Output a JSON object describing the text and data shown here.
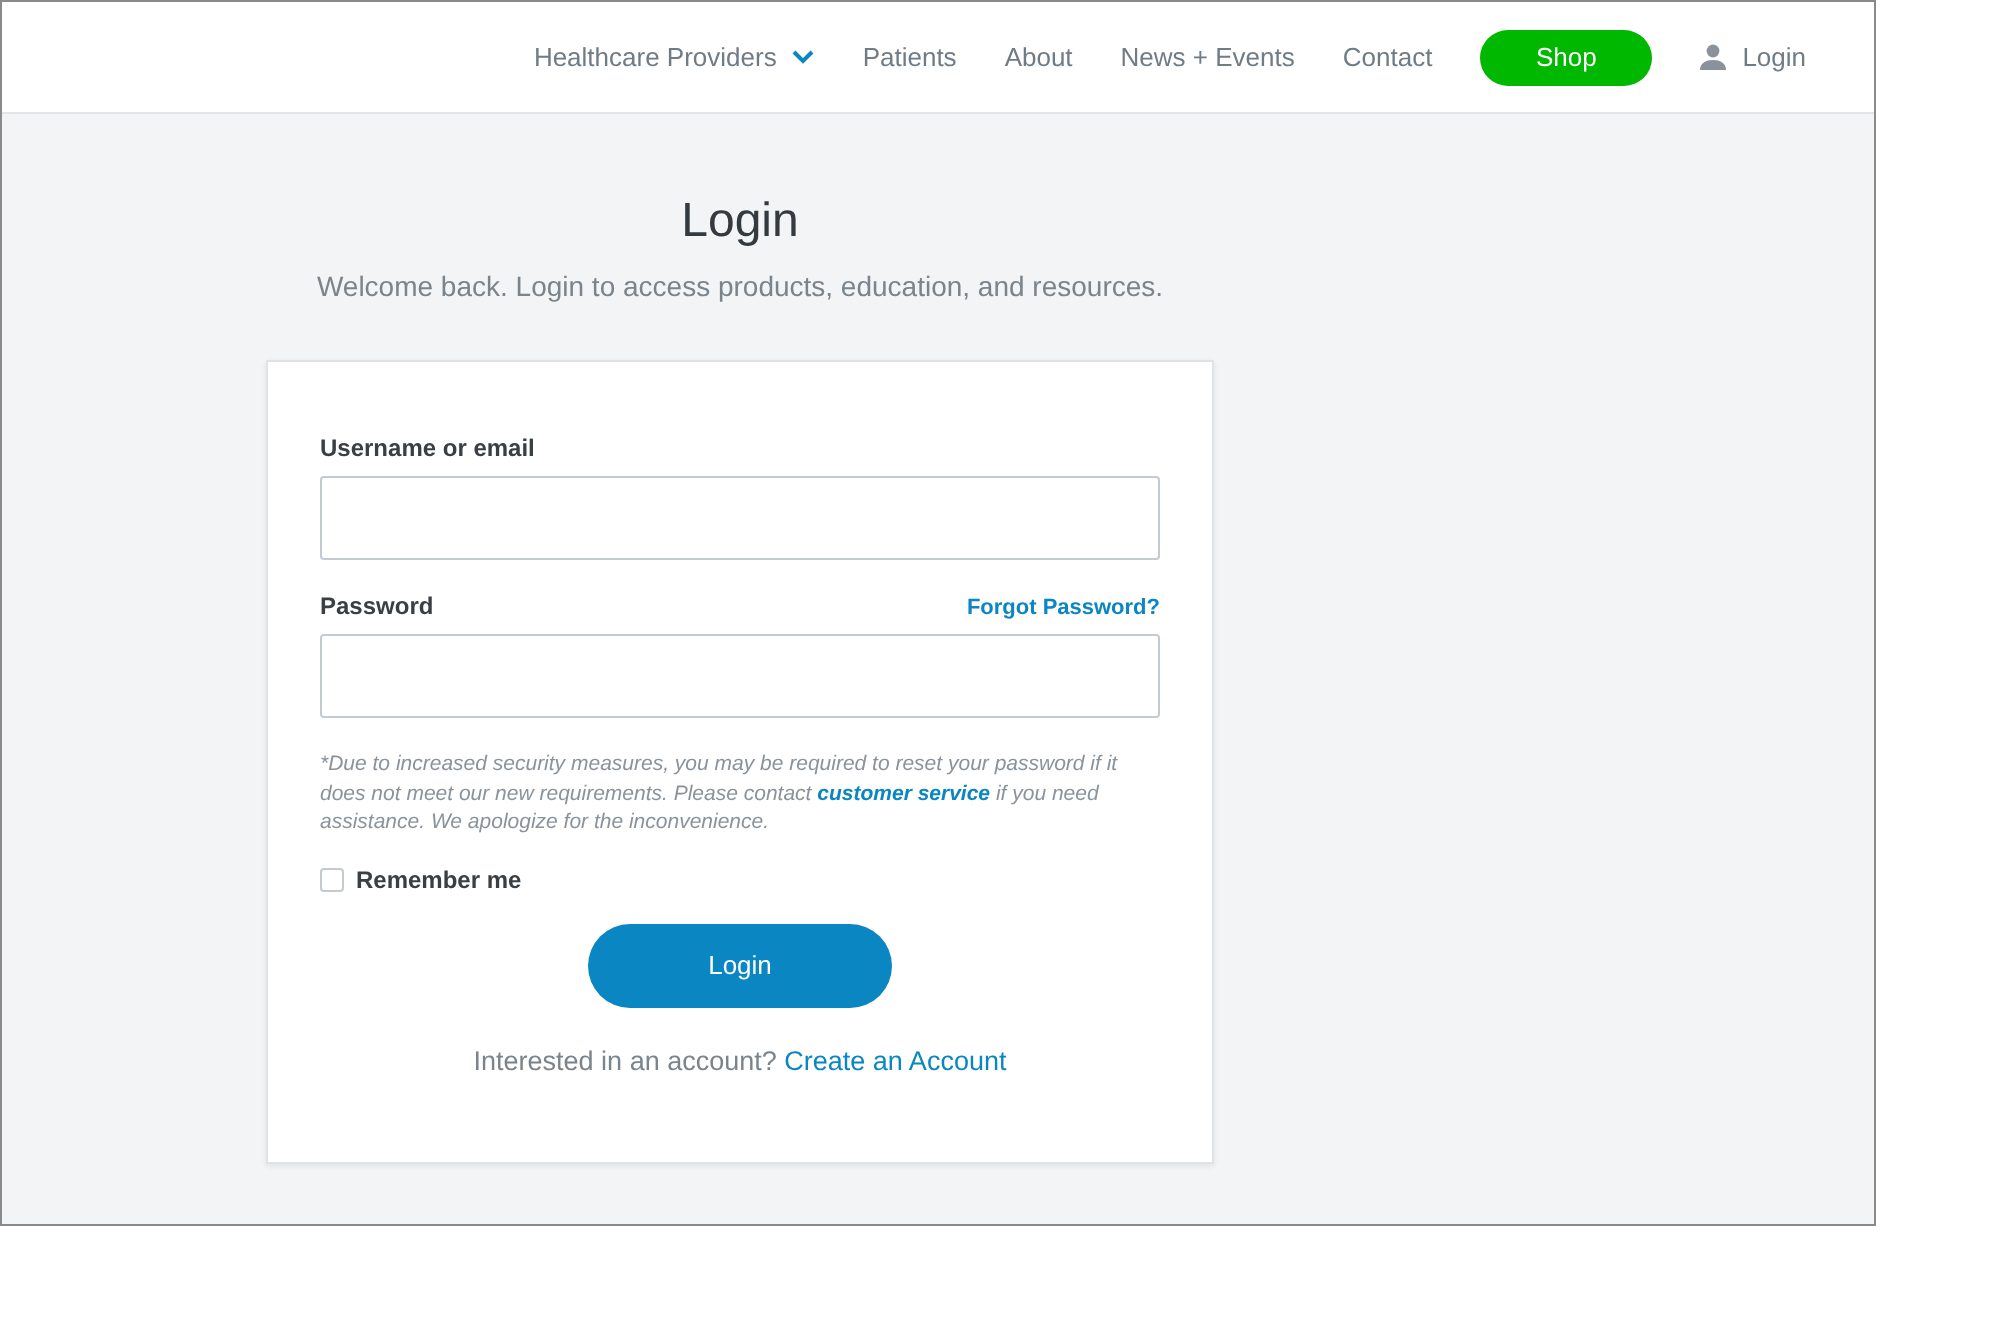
{
  "nav": {
    "items": [
      {
        "label": "Healthcare Providers",
        "kind": "dropdown"
      },
      {
        "label": "Patients",
        "kind": "link"
      },
      {
        "label": "About",
        "kind": "link"
      },
      {
        "label": "News + Events",
        "kind": "link"
      },
      {
        "label": "Contact",
        "kind": "link"
      },
      {
        "label": "Shop",
        "kind": "button"
      },
      {
        "label": "Login",
        "kind": "account"
      }
    ]
  },
  "heading": {
    "title": "Login",
    "subtitle": "Welcome back. Login to access products, education, and resources."
  },
  "form": {
    "fields": [
      {
        "label": "Username or email"
      },
      {
        "label": "Password",
        "link": "Forgot Password?"
      }
    ],
    "notice": {
      "before": "*Due to increased security measures, you may be required to reset your password if it does not meet our new requirements. Please contact ",
      "link": "customer service",
      "after": " if you need assistance. We apologize for the inconvenience."
    },
    "remember": {
      "label": "Remember me",
      "checked": false
    },
    "submit": "Login",
    "signup": {
      "prompt": "Interested in an account?",
      "link": "Create an Account"
    }
  }
}
